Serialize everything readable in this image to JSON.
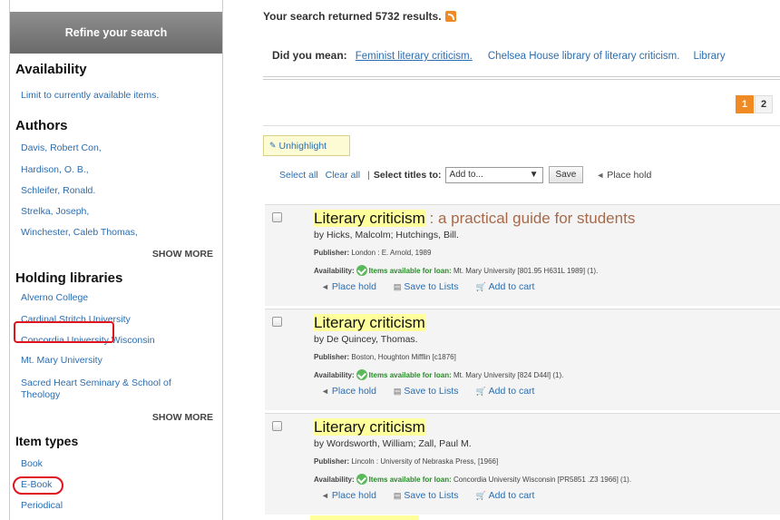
{
  "sidebar": {
    "title": "Refine your search",
    "availability": {
      "heading": "Availability",
      "items": [
        "Limit to currently available items."
      ]
    },
    "authors": {
      "heading": "Authors",
      "items": [
        "Davis, Robert Con,",
        "Hardison, O. B.,",
        "Schleifer, Ronald.",
        "Strelka, Joseph,",
        "Winchester, Caleb Thomas,"
      ],
      "show_more": "SHOW MORE"
    },
    "holding": {
      "heading": "Holding libraries",
      "items": [
        "Alverno College",
        "Cardinal Stritch University",
        "Concordia University Wisconsin",
        "Mt. Mary University",
        "Sacred Heart Seminary & School of",
        "Theology"
      ],
      "show_more": "SHOW MORE"
    },
    "item_types": {
      "heading": "Item types",
      "items": [
        "Book",
        "E-Book",
        "Periodical"
      ]
    }
  },
  "main": {
    "results_text": "Your search returned 5732 results.",
    "did_you_mean": {
      "label": "Did you mean:",
      "s1": "Feminist literary criticism.",
      "s2": "Chelsea House library of literary criticism.",
      "s3": "Library"
    },
    "pages": [
      "1",
      "2"
    ],
    "unhighlight": "Unhighlight",
    "toolbar": {
      "select_all": "Select all",
      "clear_all": "Clear all",
      "sep": "|",
      "select_titles": "Select titles to:",
      "add_to": "Add to...",
      "save": "Save",
      "place_hold": "Place hold"
    },
    "results": [
      {
        "t1": "Literary",
        "t2": " criticism",
        "rest": " : a practical guide for students",
        "by": "by Hicks, Malcolm; Hutchings, Bill.",
        "pub_label": "Publisher:",
        "pub": " London : E. Arnold, 1989",
        "avail_label": "Availability:",
        "avail_ok": "Items available for loan:",
        "avail_loc": " Mt. Mary University [801.95 H631L 1989] (1)."
      },
      {
        "t1": "Literary",
        "t2": " criticism",
        "rest": "",
        "by": "by De Quincey, Thomas.",
        "pub_label": "Publisher:",
        "pub": " Boston, Houghton Mifflin [c1876]",
        "avail_label": "Availability:",
        "avail_ok": "Items available for loan:",
        "avail_loc": " Mt. Mary University [824 D44l] (1)."
      },
      {
        "t1": "Literary",
        "t2": " criticism",
        "rest": "",
        "by": "by Wordsworth, William; Zall, Paul M.",
        "pub_label": "Publisher:",
        "pub": " Lincoln : University of Nebraska Press, [1966]",
        "avail_label": "Availability:",
        "avail_ok": "Items available for loan:",
        "avail_loc": " Concordia University Wisconsin [PR5851 .Z3 1966] (1)."
      }
    ],
    "actions": {
      "place_hold": "Place hold",
      "save_lists": "Save to Lists",
      "add_cart": "Add to cart"
    }
  },
  "colors": {
    "link": "#2a6db0",
    "highlight": "#ffff9c",
    "annotation": "#e0141e"
  }
}
